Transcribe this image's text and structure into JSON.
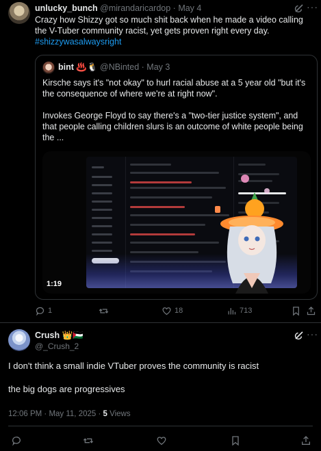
{
  "parent_tweet": {
    "name": "unlucky_bunch",
    "handle": "@mirandaricardop",
    "date": "May 4",
    "text": "Crazy how Shizzy got so much shit back when he made a video calling the V-Tuber community racist, yet gets proven right every day.",
    "hashtag": "#shizzywasalwaysright",
    "quote": {
      "name": "bint ♨️🐧",
      "handle": "@NBinted",
      "date": "May 3",
      "paragraph1": "Kirsche says it's \"not okay\" to hurl racial abuse at a 5 year old \"but it's the consequence of where we're at right now\".",
      "paragraph2": "Invokes George Floyd to say there's a \"two-tier justice system\", and that people calling children slurs is an outcome of white people being the ...",
      "video_duration": "1:19"
    },
    "actions": {
      "replies": "1",
      "likes": "18",
      "views": "713"
    }
  },
  "main_tweet": {
    "name": "Crush 👑🇵🇸",
    "handle": "@_Crush_2",
    "paragraph1": "I don't think a small indie VTuber proves the community is racist",
    "paragraph2": "the big dogs are progressives",
    "timestamp": "12:06 PM · May 11, 2025 ·",
    "views_count": "5",
    "views_label": "Views"
  },
  "icons": {
    "reply": "reply-icon",
    "retweet": "retweet-icon",
    "like": "heart-icon",
    "views": "views-icon",
    "bookmark": "bookmark-icon",
    "share": "share-icon",
    "grok": "grok-icon",
    "more": "more-icon"
  },
  "colors": {
    "background": "#000000",
    "text": "#e7e9ea",
    "muted": "#71767b",
    "link": "#1d9bf0",
    "border": "#2f3336"
  }
}
